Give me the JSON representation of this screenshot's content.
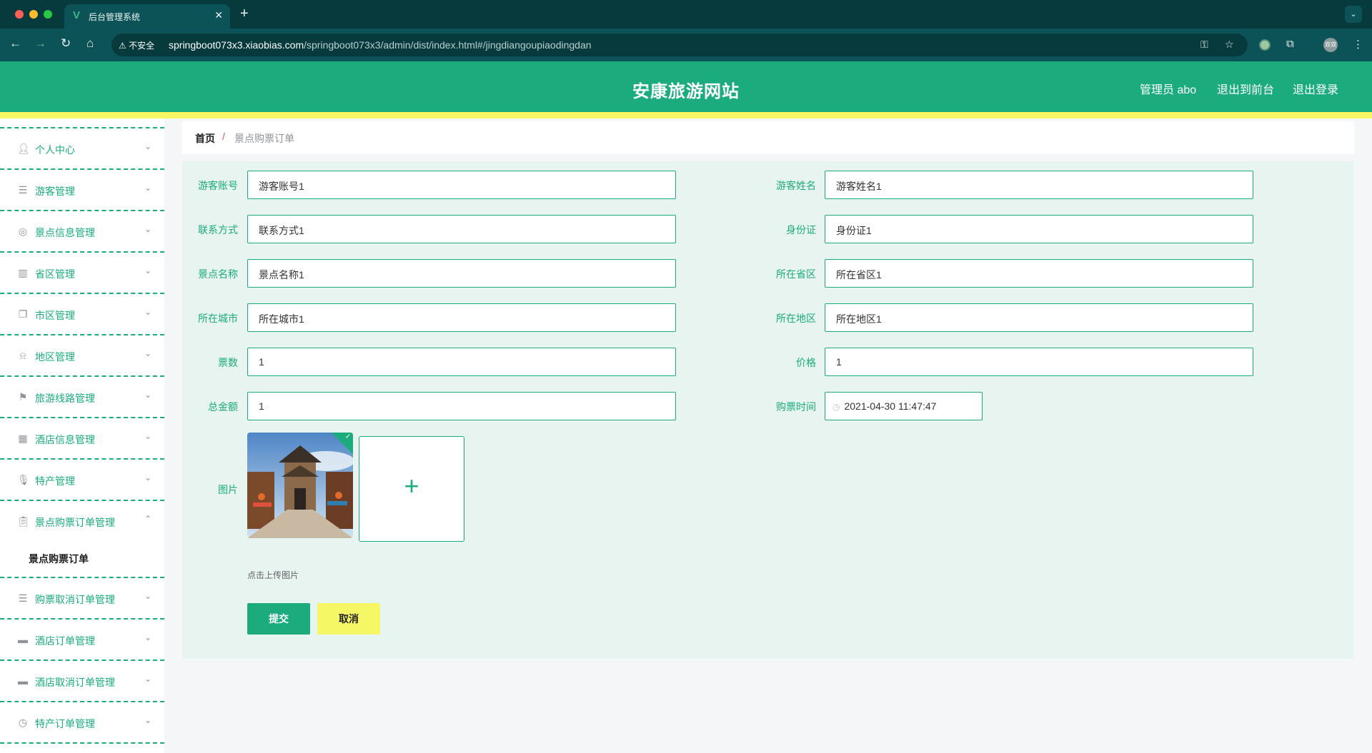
{
  "browser": {
    "tab_title": "后台管理系统",
    "tab_favicon": "V",
    "security_label": "不安全",
    "url_host": "springboot073x3.xiaobias.com",
    "url_path": "/springboot073x3/admin/dist/index.html#/jingdiangoupiaodingdan",
    "profile_label": "双双"
  },
  "header": {
    "site_title": "安康旅游网站",
    "user_label": "管理员 abo",
    "exit_front": "退出到前台",
    "logout": "退出登录",
    "brand_color": "#1bab7d",
    "accent_color": "#f5f764"
  },
  "sidebar": {
    "items": [
      {
        "label": "个人中心",
        "icon": "user-icon",
        "expanded": false
      },
      {
        "label": "游客管理",
        "icon": "list-icon",
        "expanded": false
      },
      {
        "label": "景点信息管理",
        "icon": "compass-icon",
        "expanded": false
      },
      {
        "label": "省区管理",
        "icon": "bar-chart-icon",
        "expanded": false
      },
      {
        "label": "市区管理",
        "icon": "copy-icon",
        "expanded": false
      },
      {
        "label": "地区管理",
        "icon": "bell-off-icon",
        "expanded": false
      },
      {
        "label": "旅游线路管理",
        "icon": "flag-icon",
        "expanded": false
      },
      {
        "label": "酒店信息管理",
        "icon": "grid-icon",
        "expanded": false
      },
      {
        "label": "特产管理",
        "icon": "microphone-icon",
        "expanded": false
      },
      {
        "label": "景点购票订单管理",
        "icon": "clipboard-icon",
        "expanded": true
      },
      {
        "label": "购票取消订单管理",
        "icon": "list-icon",
        "expanded": false
      },
      {
        "label": "酒店订单管理",
        "icon": "monitor-icon",
        "expanded": false
      },
      {
        "label": "酒店取消订单管理",
        "icon": "printer-icon",
        "expanded": false
      },
      {
        "label": "特产订单管理",
        "icon": "clock-icon",
        "expanded": false
      }
    ],
    "sub_item": "景点购票订单"
  },
  "breadcrumb": {
    "home": "首页",
    "separator": "/",
    "current": "景点购票订单"
  },
  "form": {
    "fields": {
      "visitor_account": {
        "label": "游客账号",
        "value": "游客账号1"
      },
      "visitor_name": {
        "label": "游客姓名",
        "value": "游客姓名1"
      },
      "contact": {
        "label": "联系方式",
        "value": "联系方式1"
      },
      "id_card": {
        "label": "身份证",
        "value": "身份证1"
      },
      "spot_name": {
        "label": "景点名称",
        "value": "景点名称1"
      },
      "province": {
        "label": "所在省区",
        "value": "所在省区1"
      },
      "city": {
        "label": "所在城市",
        "value": "所在城市1"
      },
      "district": {
        "label": "所在地区",
        "value": "所在地区1"
      },
      "ticket_count": {
        "label": "票数",
        "value": "1"
      },
      "price": {
        "label": "价格",
        "value": "1"
      },
      "total": {
        "label": "总金额",
        "value": "1"
      },
      "purchase_time": {
        "label": "购票时间",
        "value": "2021-04-30 11:47:47"
      }
    },
    "image_label": "图片",
    "upload_tip": "点击上传图片",
    "submit": "提交",
    "cancel": "取消"
  }
}
